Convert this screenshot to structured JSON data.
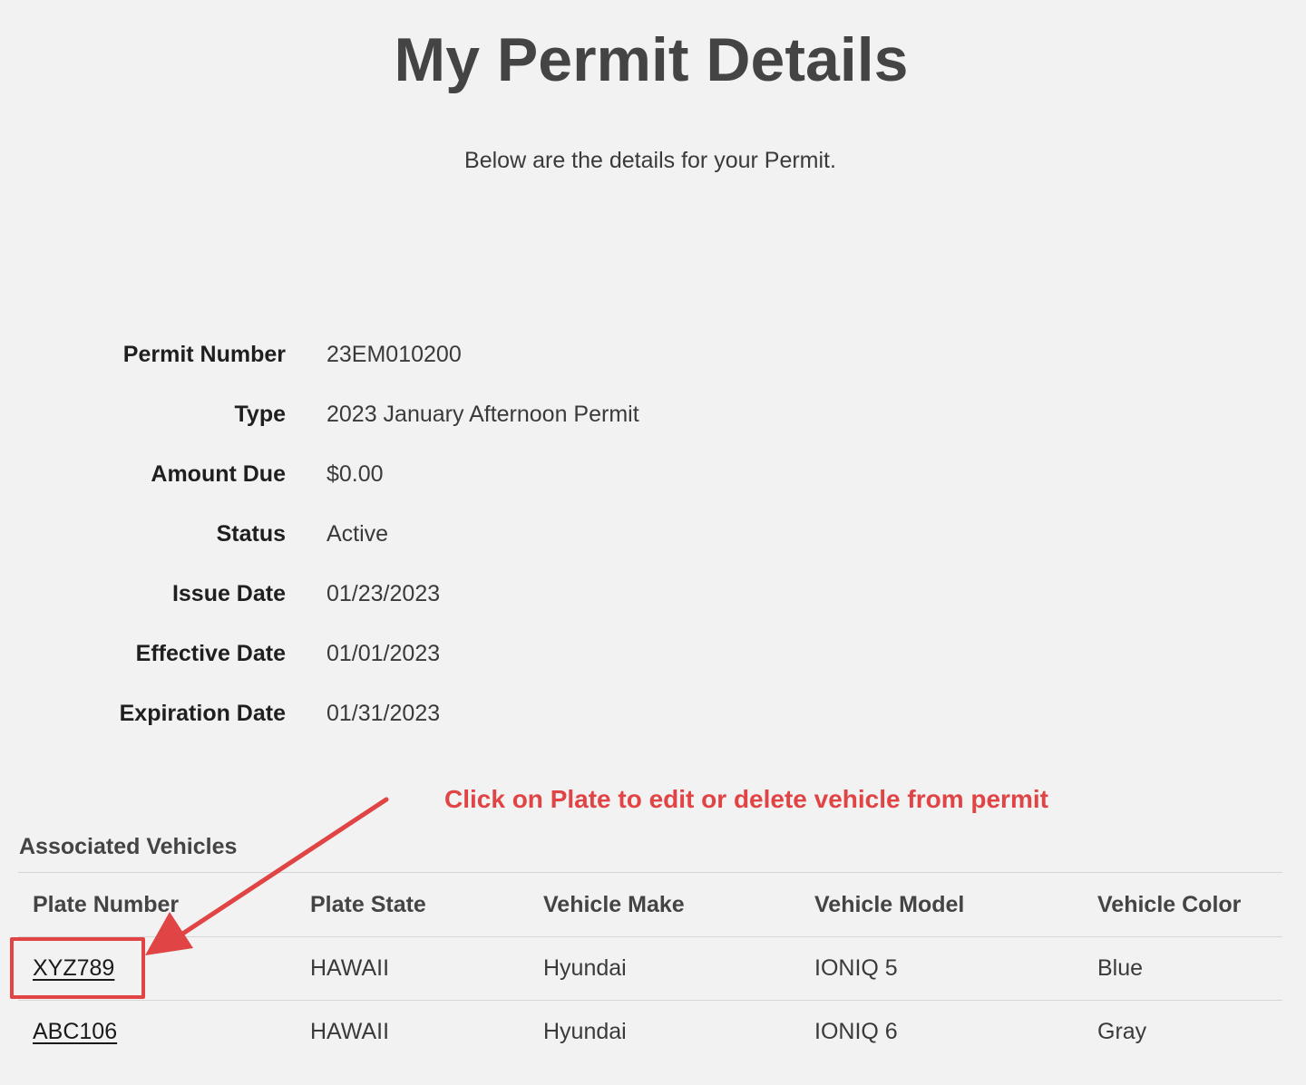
{
  "page": {
    "title": "My Permit Details",
    "subtitle": "Below are the details for your Permit."
  },
  "details": [
    {
      "label": "Permit Number",
      "value": "23EM010200"
    },
    {
      "label": "Type",
      "value": "2023 January Afternoon Permit"
    },
    {
      "label": "Amount Due",
      "value": "$0.00"
    },
    {
      "label": "Status",
      "value": "Active"
    },
    {
      "label": "Issue Date",
      "value": "01/23/2023"
    },
    {
      "label": "Effective Date",
      "value": "01/01/2023"
    },
    {
      "label": "Expiration Date",
      "value": "01/31/2023"
    }
  ],
  "annotation": {
    "text": "Click on Plate to edit or delete vehicle from permit",
    "color": "#e04444"
  },
  "vehicles": {
    "title": "Associated Vehicles",
    "columns": [
      "Plate Number",
      "Plate State",
      "Vehicle Make",
      "Vehicle Model",
      "Vehicle Color"
    ],
    "rows": [
      {
        "plate": "XYZ789",
        "state": "HAWAII",
        "make": "Hyundai",
        "model": "IONIQ 5",
        "color": "Blue"
      },
      {
        "plate": "ABC106",
        "state": "HAWAII",
        "make": "Hyundai",
        "model": "IONIQ 6",
        "color": "Gray"
      }
    ]
  }
}
